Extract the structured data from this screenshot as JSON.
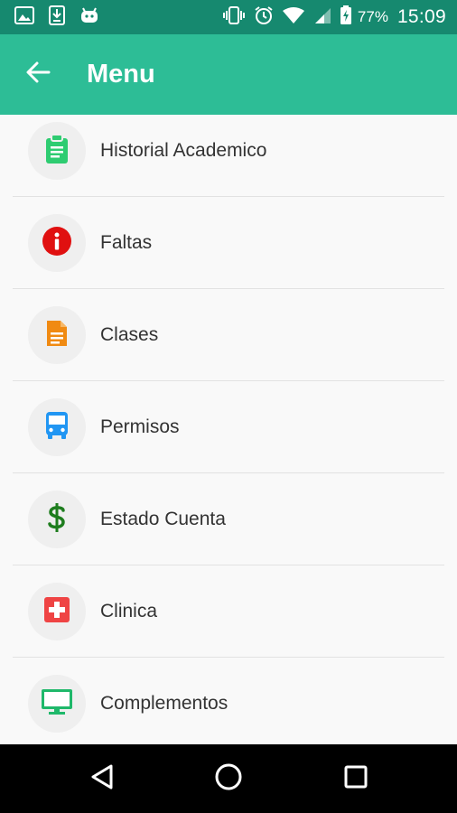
{
  "status_bar": {
    "battery_percent": "77%",
    "time": "15:09",
    "left_icons": [
      "image-icon",
      "download-icon",
      "android-icon"
    ],
    "right_icons": [
      "vibrate-icon",
      "alarm-icon",
      "wifi-icon",
      "signal-icon",
      "battery-charging-icon"
    ]
  },
  "app_bar": {
    "title": "Menu",
    "back_icon": "arrow-back-icon",
    "color": "#2dbd96",
    "status_color": "#16896f"
  },
  "menu": {
    "items": [
      {
        "label": "Historial Academico",
        "icon": "clipboard-icon",
        "color": "#2ecc71"
      },
      {
        "label": "Faltas",
        "icon": "info-icon",
        "color": "#e01010"
      },
      {
        "label": "Clases",
        "icon": "document-icon",
        "color": "#f08a12"
      },
      {
        "label": "Permisos",
        "icon": "bus-icon",
        "color": "#2196f3"
      },
      {
        "label": "Estado Cuenta",
        "icon": "dollar-icon",
        "color": "#1e7d1e"
      },
      {
        "label": "Clinica",
        "icon": "medical-cross-icon",
        "color": "#ef4444"
      },
      {
        "label": "Complementos",
        "icon": "monitor-icon",
        "color": "#1fb86a"
      }
    ]
  },
  "nav_bar": {
    "buttons": [
      "back-triangle-icon",
      "home-circle-icon",
      "recents-square-icon"
    ]
  }
}
